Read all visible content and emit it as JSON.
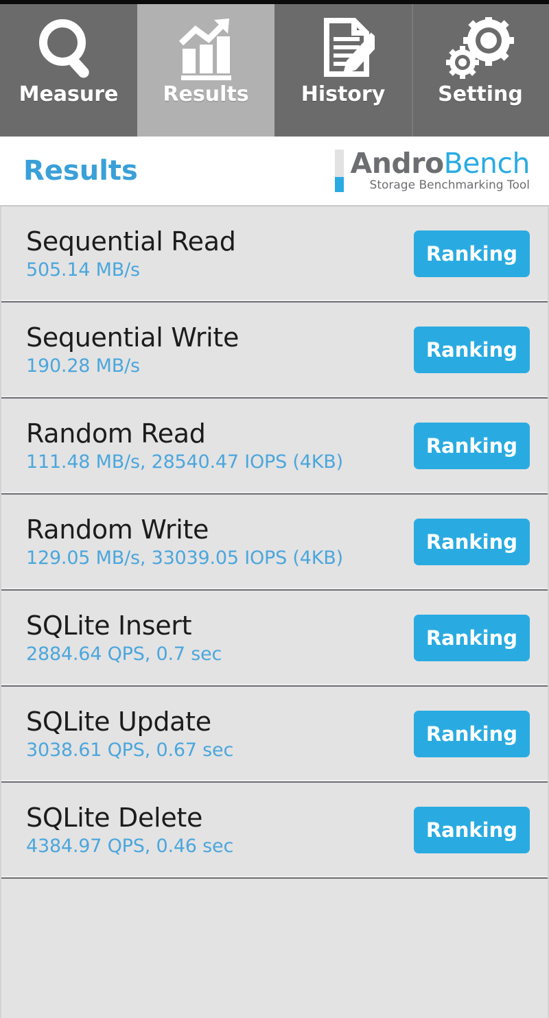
{
  "tabs": [
    {
      "label": "Measure",
      "icon": "magnifier-icon",
      "active": false
    },
    {
      "label": "Results",
      "icon": "bar-chart-arrow-icon",
      "active": true
    },
    {
      "label": "History",
      "icon": "document-pencil-icon",
      "active": false
    },
    {
      "label": "Setting",
      "icon": "gears-icon",
      "active": false
    }
  ],
  "header": {
    "title": "Results",
    "logo_primary": "Andro",
    "logo_secondary": "Bench",
    "logo_tagline": "Storage Benchmarking Tool"
  },
  "results": [
    {
      "name": "Sequential Read",
      "value": "505.14 MB/s",
      "button": "Ranking"
    },
    {
      "name": "Sequential Write",
      "value": "190.28 MB/s",
      "button": "Ranking"
    },
    {
      "name": "Random Read",
      "value": "111.48 MB/s, 28540.47 IOPS (4KB)",
      "button": "Ranking"
    },
    {
      "name": "Random Write",
      "value": "129.05 MB/s, 33039.05 IOPS (4KB)",
      "button": "Ranking"
    },
    {
      "name": "SQLite Insert",
      "value": "2884.64 QPS, 0.7 sec",
      "button": "Ranking"
    },
    {
      "name": "SQLite Update",
      "value": "3038.61 QPS, 0.67 sec",
      "button": "Ranking"
    },
    {
      "name": "SQLite Delete",
      "value": "4384.97 QPS, 0.46 sec",
      "button": "Ranking"
    }
  ],
  "colors": {
    "accent_blue": "#29abe2",
    "value_blue": "#4ba6dd",
    "tab_inactive": "#6b6b6b",
    "tab_active": "#b1b1b1",
    "row_background": "#e3e3e3"
  }
}
